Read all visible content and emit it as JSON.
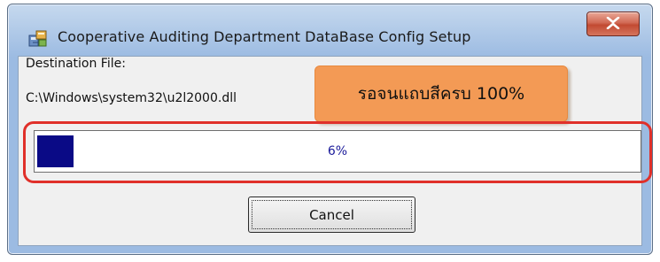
{
  "window": {
    "title": "Cooperative Auditing Department DataBase Config Setup",
    "close_icon": "close-x-icon",
    "app_icon": "setup-installer-icon"
  },
  "content": {
    "destination_label": "Destination File:",
    "destination_path": "C:\\Windows\\system32\\u2l2000.dll"
  },
  "progress": {
    "percent_text": "6%",
    "value_fraction": 0.06,
    "fill_color": "#0a0a86"
  },
  "callout": {
    "text": "รอจนแถบสีครบ 100%",
    "color": "#f39a55"
  },
  "highlight": {
    "color": "#e0302a"
  },
  "buttons": {
    "cancel_label": "Cancel"
  }
}
